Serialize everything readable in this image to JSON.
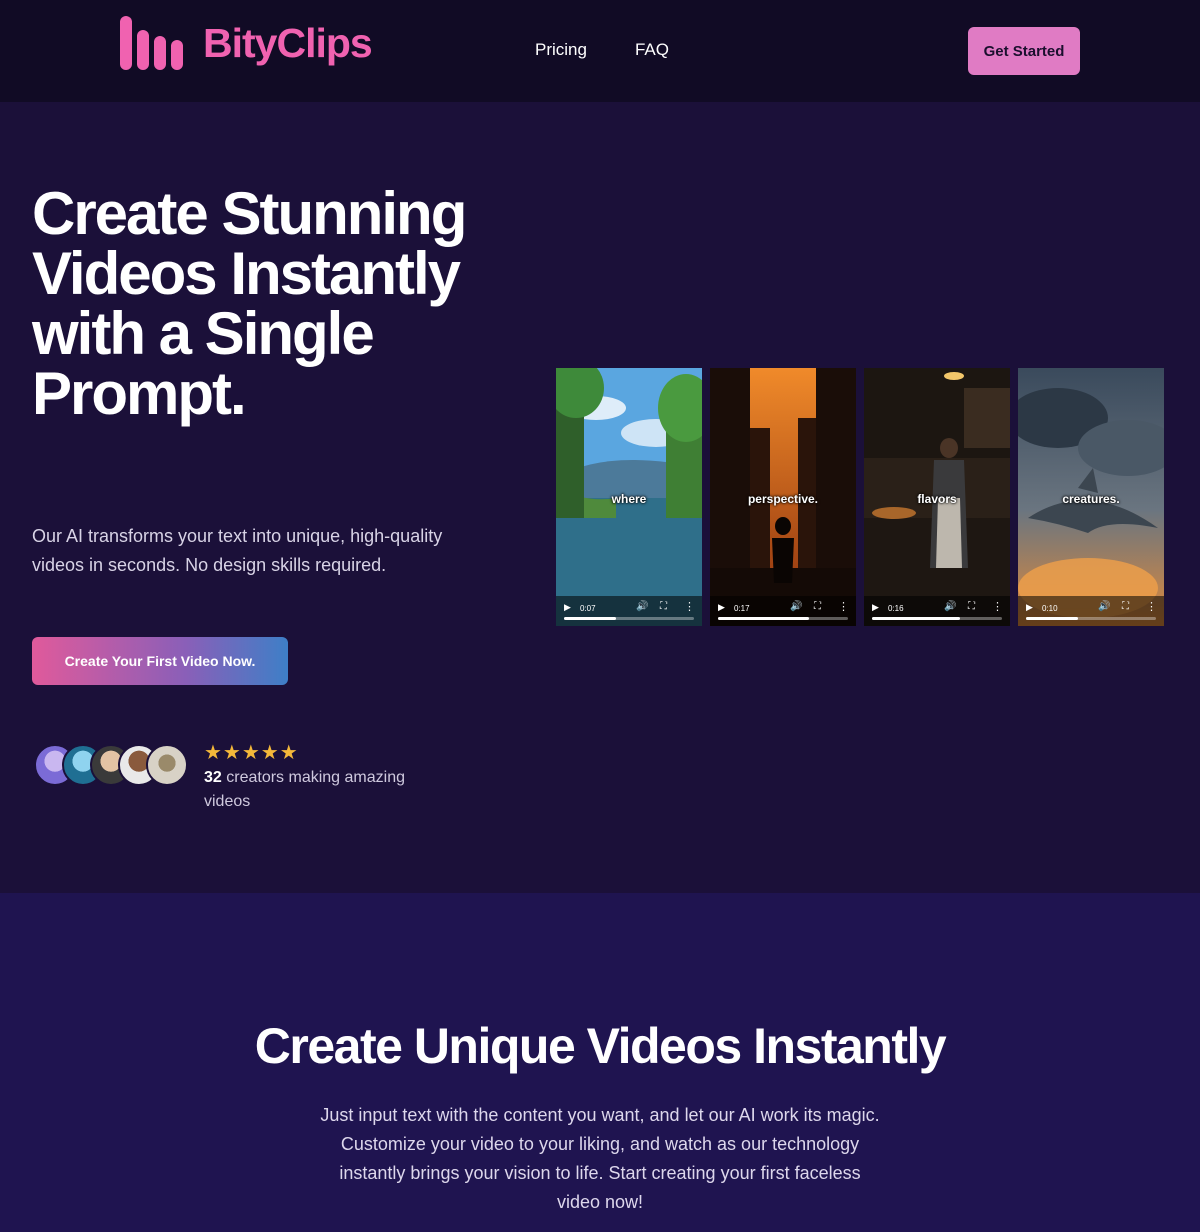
{
  "nav": {
    "brand": "BityClips",
    "links": [
      "Pricing",
      "FAQ"
    ],
    "get_started": "Get Started"
  },
  "hero": {
    "title": "Create Stunning Videos Instantly with a Single Prompt.",
    "subtitle": "Our AI transforms your text into unique, high-quality videos in seconds. No design skills required.",
    "cta": "Create Your First Video Now.",
    "rating_stars": "★★★★★",
    "creators_count": "32",
    "creators_text": " creators making amazing videos"
  },
  "clips": [
    {
      "caption": "where",
      "time": "0:07",
      "progress": 0.4
    },
    {
      "caption": "perspective.",
      "time": "0:17",
      "progress": 0.7
    },
    {
      "caption": "flavors",
      "time": "0:16",
      "progress": 0.68
    },
    {
      "caption": "creatures.",
      "time": "0:10",
      "progress": 0.4
    }
  ],
  "section2": {
    "title": "Create Unique Videos Instantly",
    "body": "Just input text with the content you want, and let our AI work its magic. Customize your video to your liking, and watch as our technology instantly brings your vision to life. Start creating your first faceless video now!"
  },
  "colors": {
    "brand_pink": "#f062b0",
    "button_pink": "#e07bc4",
    "hero_bg": "#1b1039",
    "nav_bg": "#110b25",
    "star": "#f4b83a"
  },
  "icons": [
    "logo-bars-icon",
    "star-icon",
    "play-icon",
    "volume-icon",
    "fullscreen-icon",
    "more-icon"
  ]
}
